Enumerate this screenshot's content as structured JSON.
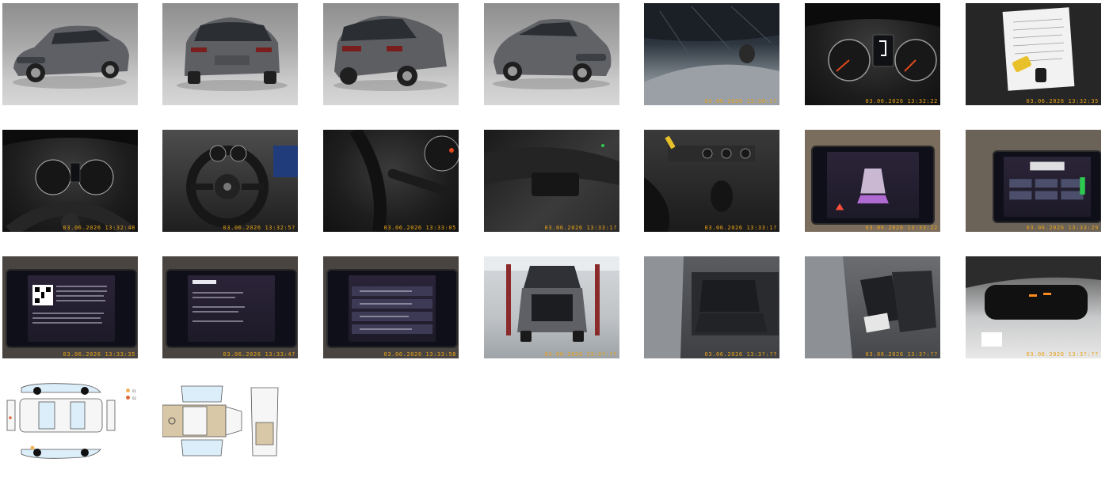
{
  "gallery": {
    "photos": [
      {
        "kind": "exterior-front-left",
        "stamp": ""
      },
      {
        "kind": "exterior-rear",
        "stamp": ""
      },
      {
        "kind": "exterior-rear-right",
        "stamp": ""
      },
      {
        "kind": "exterior-front-right",
        "stamp": ""
      },
      {
        "kind": "glass-detail",
        "stamp": "03.06.2026 13:30:1?"
      },
      {
        "kind": "instrument-cluster",
        "stamp": "03.06.2026 13:32:22"
      },
      {
        "kind": "documents-and-keys",
        "stamp": "03.06.2026 13:32:35"
      },
      {
        "kind": "instrument-cluster-wide",
        "stamp": "03.06.2026 13:32:48"
      },
      {
        "kind": "steering-wheel",
        "stamp": "03.06.2026 13:32:5?"
      },
      {
        "kind": "steering-stalk",
        "stamp": "03.06.2026 13:33:05"
      },
      {
        "kind": "door-panel",
        "stamp": "03.06.2026 13:33:1?"
      },
      {
        "kind": "center-console",
        "stamp": "03.06.2026 13:33:1?"
      },
      {
        "kind": "infotainment-parking",
        "stamp": "03.06.2026 13:33:22"
      },
      {
        "kind": "infotainment-climate",
        "stamp": "03.06.2026 13:33:29"
      },
      {
        "kind": "infotainment-qr",
        "stamp": "03.06.2026 13:33:35"
      },
      {
        "kind": "infotainment-service",
        "stamp": "03.06.2026 13:33:4?"
      },
      {
        "kind": "infotainment-settings",
        "stamp": "03.06.2026 13:33:58"
      },
      {
        "kind": "trunk-open",
        "stamp": "03.06.2026 13:3?:??"
      },
      {
        "kind": "rear-seats",
        "stamp": "03.06.2026 13:3?:??"
      },
      {
        "kind": "front-seats",
        "stamp": "03.06.2026 13:3?:??"
      },
      {
        "kind": "rearview-mirror",
        "stamp": "03.06.2026 13:3?:??"
      }
    ],
    "damage_legend": [
      {
        "label": "01",
        "color": "#f2b35a"
      },
      {
        "label": "02",
        "color": "#e0673a"
      }
    ]
  }
}
